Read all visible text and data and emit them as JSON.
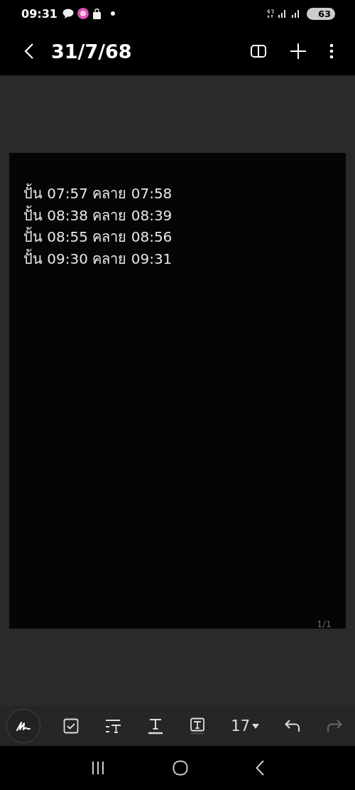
{
  "status_bar": {
    "time": "09:31",
    "battery": "63"
  },
  "header": {
    "title": "31/7/68"
  },
  "note": {
    "lines": [
      "ปั้น 07:57 คลาย 07:58",
      "ปั้น 08:38 คลาย 08:39",
      "ปั้น 08:55 คลาย 08:56",
      "ปั้น 09:30 คลาย 09:31"
    ],
    "page_indicator": "1/1"
  },
  "toolbar": {
    "font_size": "17",
    "undo_disabled": false,
    "redo_disabled": true
  }
}
